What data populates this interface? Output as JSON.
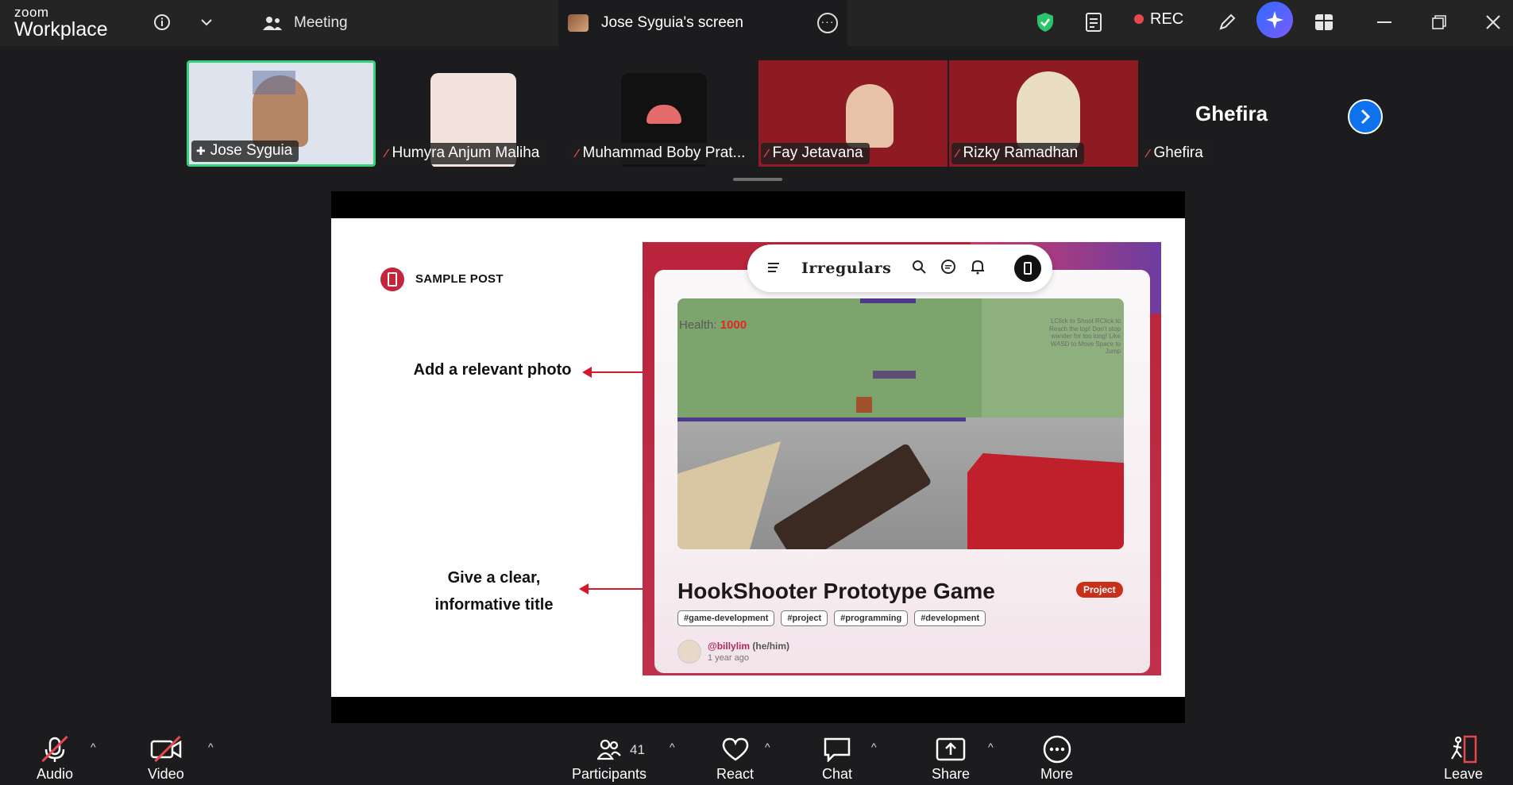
{
  "titlebar": {
    "brand_small": "zoom",
    "brand_big": "Workplace",
    "meeting_tab": "Meeting",
    "screen_tab": "Jose Syguia's screen",
    "rec_label": "REC"
  },
  "participants": [
    {
      "name": "Jose Syguia",
      "active": true,
      "muted": false
    },
    {
      "name": "Humyra Anjum Maliha",
      "active": false,
      "muted": true
    },
    {
      "name": "Muhammad Boby Prat...",
      "active": false,
      "muted": true
    },
    {
      "name": "Fay Jetavana",
      "active": false,
      "muted": true
    },
    {
      "name": "Rizky Ramadhan",
      "active": false,
      "muted": true
    },
    {
      "name": "Ghefira",
      "active": false,
      "muted": true
    }
  ],
  "ghefira_display": "Ghefira",
  "slide": {
    "section_label": "SAMPLE POST",
    "annotation_photo": "Add a relevant photo",
    "annotation_title_line1": "Give a clear,",
    "annotation_title_line2": "informative title",
    "nav_logo": "Irregulars",
    "game_health_label": "Health:",
    "game_health_value": "1000",
    "game_help": "LClick to Shoot RClick to Reach the top! Don't stop wander for too long! Like WASD to Move Space to Jump",
    "post_title": "HookShooter Prototype Game",
    "badge": "Project",
    "tags": [
      "#game-development",
      "#project",
      "#programming",
      "#development"
    ],
    "author_handle": "@billylim",
    "author_pronouns": "(he/him)",
    "author_time": "1 year ago"
  },
  "toolbar": {
    "audio": "Audio",
    "video": "Video",
    "participants": "Participants",
    "participants_count": "41",
    "react": "React",
    "chat": "Chat",
    "share": "Share",
    "more": "More",
    "leave": "Leave"
  },
  "colors": {
    "accent_blue": "#0e72ed",
    "active_green": "#33d17a",
    "mute_red": "#e5484d",
    "slide_red": "#d3192e"
  }
}
